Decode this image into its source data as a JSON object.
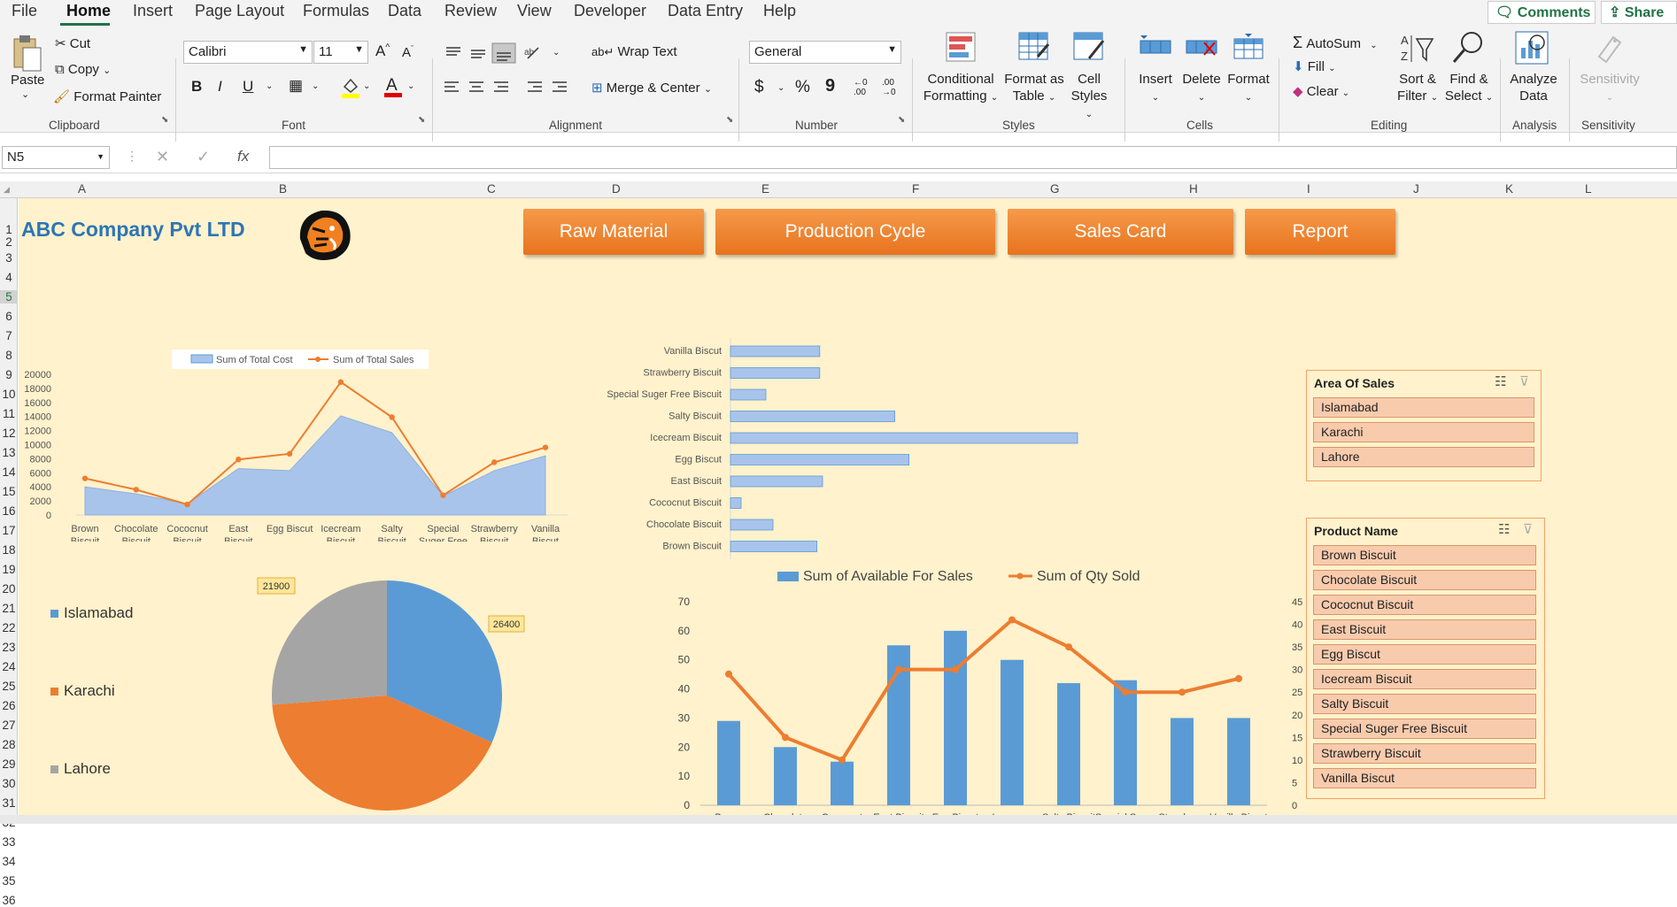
{
  "menu": [
    "File",
    "Home",
    "Insert",
    "Page Layout",
    "Formulas",
    "Data",
    "Review",
    "View",
    "Developer",
    "Data Entry",
    "Help"
  ],
  "menu_active": "Home",
  "comments_label": "Comments",
  "share_label": "Share",
  "ribbon": {
    "clipboard": {
      "paste": "Paste",
      "cut": "Cut",
      "copy": "Copy",
      "format_painter": "Format Painter",
      "group": "Clipboard"
    },
    "font": {
      "name": "Calibri",
      "size": "11",
      "bold": "B",
      "italic": "I",
      "underline": "U",
      "group": "Font"
    },
    "alignment": {
      "wrap": "Wrap Text",
      "merge": "Merge & Center",
      "group": "Alignment"
    },
    "number": {
      "format": "General",
      "dollar": "$",
      "percent": "%",
      "comma": "9",
      "inc": "←0 .00",
      "dec": ".00 →0",
      "group": "Number"
    },
    "styles": {
      "conditional_1": "Conditional",
      "conditional_2": "Formatting",
      "format_table_1": "Format as",
      "format_table_2": "Table",
      "cell_styles_1": "Cell",
      "cell_styles_2": "Styles",
      "group": "Styles"
    },
    "cells": {
      "insert": "Insert",
      "delete": "Delete",
      "format": "Format",
      "group": "Cells"
    },
    "editing": {
      "autosum": "AutoSum",
      "fill": "Fill",
      "clear": "Clear",
      "sort_1": "Sort &",
      "sort_2": "Filter",
      "find_1": "Find &",
      "find_2": "Select",
      "group": "Editing"
    },
    "analysis": {
      "analyze_1": "Analyze",
      "analyze_2": "Data",
      "group": "Analysis"
    },
    "sensitivity": {
      "label": "Sensitivity",
      "group": "Sensitivity"
    }
  },
  "name_box": "N5",
  "fx": "fx",
  "columns": [
    "A",
    "B",
    "C",
    "D",
    "E",
    "F",
    "G",
    "H",
    "I",
    "J",
    "K",
    "L"
  ],
  "rows": [
    "1",
    "2",
    "3",
    "4",
    "5",
    "6",
    "7",
    "8",
    "9",
    "10",
    "11",
    "12",
    "13",
    "14",
    "15",
    "16",
    "17",
    "18",
    "19",
    "20",
    "21",
    "22",
    "23",
    "24",
    "25",
    "26",
    "27",
    "28",
    "29",
    "30",
    "31",
    "32",
    "33",
    "34",
    "35",
    "36"
  ],
  "company": "ABC Company Pvt LTD",
  "nav_buttons": [
    "Raw Material",
    "Production Cycle",
    "Sales Card",
    "Report"
  ],
  "slicer_area": {
    "title": "Area Of Sales",
    "items": [
      "Islamabad",
      "Karachi",
      "Lahore"
    ]
  },
  "slicer_product": {
    "title": "Product Name",
    "items": [
      "Brown Biscuit",
      "Chocolate Biscuit",
      "Cococnut Biscuit",
      "East Biscuit",
      "Egg Biscut",
      "Icecream Biscuit",
      "Salty Biscuit",
      "Special Suger Free Biscuit",
      "Strawberry Biscuit",
      "Vanilla Biscut"
    ]
  },
  "colors": {
    "accent": "#217346",
    "blue": "#5b9bd5",
    "orange": "#ed7d31",
    "gray": "#a5a5a5",
    "sheet": "#fff2cc",
    "button": "#ed7d31"
  },
  "chart_data": [
    {
      "type": "area",
      "categories": [
        "Brown Biscuit",
        "Chocolate Biscuit",
        "Cococnut Biscuit",
        "East Biscuit",
        "Egg Biscut",
        "Icecream Biscuit",
        "Salty Biscuit",
        "Special Suger Free Biscuit",
        "Strawberry Biscuit",
        "Vanilla Biscut"
      ],
      "series": [
        {
          "name": "Sum of Total Cost",
          "values": [
            4000,
            3000,
            1600,
            6600,
            6300,
            14100,
            11700,
            2700,
            6300,
            8400
          ]
        },
        {
          "name": "Sum of Total Sales",
          "values": [
            5200,
            3600,
            1500,
            7900,
            8700,
            18900,
            13900,
            2800,
            7500,
            9600
          ]
        }
      ],
      "yticks": [
        0,
        2000,
        4000,
        6000,
        8000,
        10000,
        12000,
        14000,
        16000,
        18000,
        20000
      ],
      "ylim": [
        0,
        20000
      ],
      "legend": "top"
    },
    {
      "type": "bar",
      "orientation": "horizontal",
      "categories": [
        "Brown Biscuit",
        "Chocolate Biscuit",
        "Cococnut Biscuit",
        "East Biscuit",
        "Egg Biscut",
        "Icecream Biscuit",
        "Salty Biscuit",
        "Special Suger Free Biscuit",
        "Strawberry Biscuit",
        "Vanilla Biscut"
      ],
      "values": [
        1220,
        600,
        150,
        1300,
        2520,
        4900,
        2320,
        500,
        1260,
        1260
      ],
      "xticks": [
        0,
        1000,
        2000,
        3000,
        4000,
        5000,
        6000
      ],
      "xlim": [
        0,
        6000
      ]
    },
    {
      "type": "pie",
      "categories": [
        "Islamabad",
        "Karachi",
        "Lahore"
      ],
      "values": [
        26400,
        35000,
        21900
      ],
      "labels": [
        "26400",
        "",
        "21900"
      ],
      "legend": "left"
    },
    {
      "type": "bar",
      "categories": [
        "Brown Biscuit",
        "Chocolate Biscuit",
        "Cococnut Biscuit",
        "East Biscuit",
        "Egg Biscut",
        "Icecream Biscuit",
        "Salty Biscuit",
        "Special Suger Free Biscuit",
        "Strawberry Biscuit",
        "Vanilla Biscut"
      ],
      "category_labels": [
        "Brown",
        "Chocolate",
        "Cococnut",
        "East Biscuit",
        "Egg Biscut",
        "Icecream",
        "Salty Biscuit",
        "Special Sugar",
        "Strawberry",
        "Vanilla Biscut"
      ],
      "series": [
        {
          "name": "Sum of Available For Sales",
          "values": [
            29,
            20,
            15,
            55,
            60,
            50,
            42,
            43,
            30,
            30
          ],
          "axis": "left"
        },
        {
          "name": "Sum of Qty Sold",
          "values": [
            29,
            15,
            10,
            30,
            30,
            41,
            35,
            25,
            25,
            28
          ],
          "axis": "right",
          "type": "line"
        }
      ],
      "yticks_left": [
        0,
        10,
        20,
        30,
        40,
        50,
        60,
        70
      ],
      "yticks_right": [
        0,
        5,
        10,
        15,
        20,
        25,
        30,
        35,
        40,
        45
      ],
      "ylim_left": [
        0,
        70
      ],
      "ylim_right": [
        0,
        45
      ],
      "legend": "top"
    }
  ]
}
